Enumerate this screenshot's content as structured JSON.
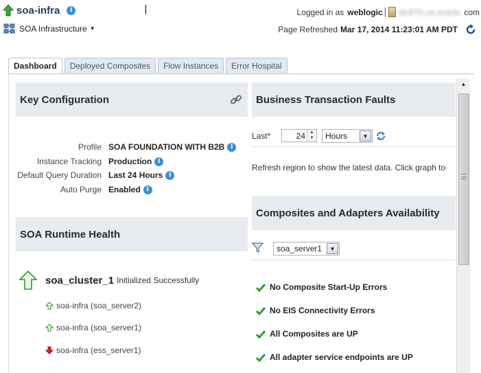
{
  "header": {
    "title": "soa-infra",
    "logged_in_prefix": "Logged in as",
    "username": "weblogic",
    "host_obscured": "slc97fz.us.oracle.",
    "host_suffix": "com",
    "menu_label": "SOA Infrastructure",
    "page_refreshed_label": "Page Refreshed",
    "page_refreshed_time": "Mar 17, 2014 11:23:01 AM PDT"
  },
  "tabs": [
    {
      "label": "Dashboard",
      "active": true
    },
    {
      "label": "Deployed Composites",
      "active": false
    },
    {
      "label": "Flow Instances",
      "active": false
    },
    {
      "label": "Error Hospital",
      "active": false
    }
  ],
  "key_configuration": {
    "title": "Key Configuration",
    "rows": [
      {
        "label": "Profile",
        "value": "SOA FOUNDATION WITH B2B"
      },
      {
        "label": "Instance Tracking",
        "value": "Production"
      },
      {
        "label": "Default Query Duration",
        "value": "Last 24 Hours"
      },
      {
        "label": "Auto Purge",
        "value": "Enabled"
      }
    ]
  },
  "runtime_health": {
    "title": "SOA Runtime Health",
    "cluster_name": "soa_cluster_1",
    "cluster_status": "Initialized Successfully",
    "servers": [
      {
        "label": "soa-infra (soa_server2)",
        "status": "up"
      },
      {
        "label": "soa-infra (soa_server1)",
        "status": "up"
      },
      {
        "label": "soa-infra (ess_server1)",
        "status": "down"
      }
    ]
  },
  "business_faults": {
    "title": "Business Transaction Faults",
    "last_label": "Last*",
    "last_value": "24",
    "unit": "Hours",
    "refresh_message": "Refresh region to show the latest data. Click graph to"
  },
  "availability": {
    "title": "Composites and Adapters Availability",
    "server_filter": "soa_server1",
    "checks": [
      "No Composite Start-Up Errors",
      "No EIS Connectivity Errors",
      "All Composites are UP",
      "All adapter service endpoints are UP"
    ]
  },
  "colors": {
    "up_green": "#3aa83a",
    "down_red": "#d8231f",
    "info_blue": "#3b8fd8",
    "header_bg": "#e8ebef"
  },
  "icons": {
    "status_up": "up-arrow-icon",
    "status_down": "down-arrow-icon",
    "info": "info-icon",
    "link": "link-icon",
    "refresh": "refresh-icon",
    "filter": "filter-icon",
    "check": "check-icon"
  }
}
